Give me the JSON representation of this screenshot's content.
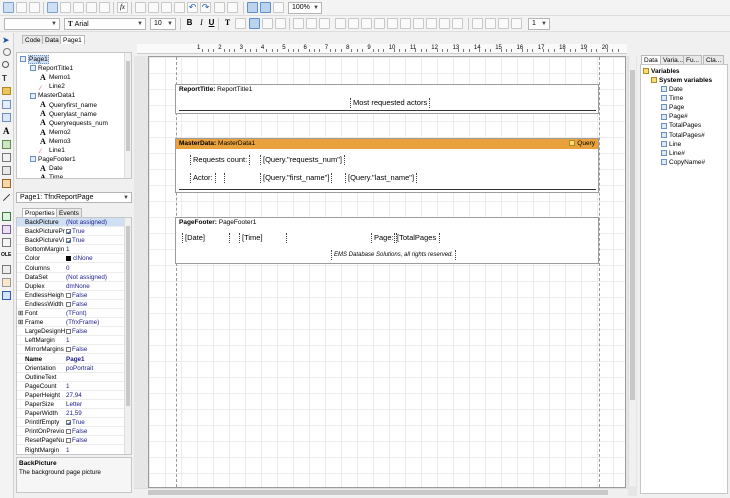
{
  "toolbar": {
    "style_combo": "",
    "font_name": "Arial",
    "font_size": "10",
    "zoom": "100%",
    "line_width": "1",
    "icons": [
      "new-icon",
      "open-icon",
      "save-icon",
      "preview-icon",
      "fx-icon",
      "cut-icon",
      "copy-icon",
      "paste-icon",
      "undo-icon",
      "redo-icon",
      "grid-icon",
      "zoom-icon"
    ]
  },
  "editor_tabs": [
    "Code",
    "Data",
    "Page1"
  ],
  "report_tree": {
    "items": [
      {
        "label": "Page1",
        "level": 0,
        "icon": "page-icon"
      },
      {
        "label": "ReportTitle1",
        "level": 1,
        "icon": "band-icon"
      },
      {
        "label": "Memo1",
        "level": 2,
        "icon": "text-icon"
      },
      {
        "label": "Line2",
        "level": 2,
        "icon": "line-icon"
      },
      {
        "label": "MasterData1",
        "level": 1,
        "icon": "band-icon"
      },
      {
        "label": "Queryfirst_name",
        "level": 2,
        "icon": "text-icon"
      },
      {
        "label": "Querylast_name",
        "level": 2,
        "icon": "text-icon"
      },
      {
        "label": "Queryrequests_num",
        "level": 2,
        "icon": "text-icon"
      },
      {
        "label": "Memo2",
        "level": 2,
        "icon": "text-icon"
      },
      {
        "label": "Memo3",
        "level": 2,
        "icon": "text-icon"
      },
      {
        "label": "Line1",
        "level": 2,
        "icon": "line-icon"
      },
      {
        "label": "PageFooter1",
        "level": 1,
        "icon": "band-icon"
      },
      {
        "label": "Date",
        "level": 2,
        "icon": "text-icon"
      },
      {
        "label": "Time",
        "level": 2,
        "icon": "text-icon"
      }
    ]
  },
  "object_selector": "Page1: TfrxReportPage",
  "inspector": {
    "tabs": [
      "Properties",
      "Events"
    ],
    "rows": [
      {
        "k": "BackPicture",
        "v": "(Not assigned)"
      },
      {
        "k": "BackPicturePr",
        "v": "True",
        "chk": true
      },
      {
        "k": "BackPictureVi",
        "v": "True",
        "chk": true
      },
      {
        "k": "BottomMargin",
        "v": "1"
      },
      {
        "k": "Color",
        "v": "clNone",
        "swatch": "#000000"
      },
      {
        "k": "Columns",
        "v": "0"
      },
      {
        "k": "DataSet",
        "v": "(Not assigned)"
      },
      {
        "k": "Duplex",
        "v": "dmNone"
      },
      {
        "k": "EndlessHeigh",
        "v": "False",
        "chk": false
      },
      {
        "k": "EndlessWidth",
        "v": "False",
        "chk": false
      },
      {
        "k": "Font",
        "v": "(TFont)",
        "plus": true
      },
      {
        "k": "Frame",
        "v": "(TfrxFrame)",
        "plus": true
      },
      {
        "k": "LargeDesignH",
        "v": "False",
        "chk": false
      },
      {
        "k": "LeftMargin",
        "v": "1"
      },
      {
        "k": "MirrorMargins",
        "v": "False",
        "chk": false
      },
      {
        "k": "Name",
        "v": "Page1",
        "bold": true
      },
      {
        "k": "Orientation",
        "v": "poPortrait"
      },
      {
        "k": "OutlineText",
        "v": ""
      },
      {
        "k": "PageCount",
        "v": "1"
      },
      {
        "k": "PaperHeight",
        "v": "27,94"
      },
      {
        "k": "PaperSize",
        "v": "Letter"
      },
      {
        "k": "PaperWidth",
        "v": "21,59"
      },
      {
        "k": "PrintIfEmpty",
        "v": "True",
        "chk": true
      },
      {
        "k": "PrintOnPrevio",
        "v": "False",
        "chk": false
      },
      {
        "k": "ResetPageNu",
        "v": "False",
        "chk": false
      },
      {
        "k": "RightMargin",
        "v": "1"
      }
    ],
    "help_title": "BackPicture",
    "help_text": "The background page picture"
  },
  "ruler": [
    "1",
    "2",
    "3",
    "4",
    "5",
    "6",
    "7",
    "8",
    "9",
    "10",
    "11",
    "12",
    "13",
    "14",
    "15",
    "16",
    "17",
    "18",
    "19",
    "20"
  ],
  "bands": {
    "report_title": {
      "type": "ReportTitle:",
      "name": "ReportTitle1",
      "memo": "Most requested actors"
    },
    "master_data": {
      "type": "MasterData:",
      "name": "MasterData1",
      "query_label": "Query",
      "requests_label": "Requests count:",
      "requests_field": "[Query.\"requests_num\"]",
      "actor_label": "Actor:",
      "first_field": "[Query.\"first_name\"]",
      "last_field": "[Query.\"last_name\"]"
    },
    "page_footer": {
      "type": "PageFooter:",
      "name": "PageFooter1",
      "date": "[Date]",
      "time": "[Time]",
      "page_label": "Page:",
      "total_pages": "[TotalPages",
      "copyright": "EMS Database Solutions, all rights reserved."
    }
  },
  "right_tabs": [
    "Data",
    "Varia...",
    "Fu...",
    "Cla..."
  ],
  "variables": {
    "root": "Variables",
    "group": "System variables",
    "items": [
      "Date",
      "Time",
      "Page",
      "Page#",
      "TotalPages",
      "TotalPages#",
      "Line",
      "Line#",
      "CopyName#"
    ]
  },
  "colors": {
    "master_header": "#e9a23b",
    "selection": "#cfe0f5"
  }
}
